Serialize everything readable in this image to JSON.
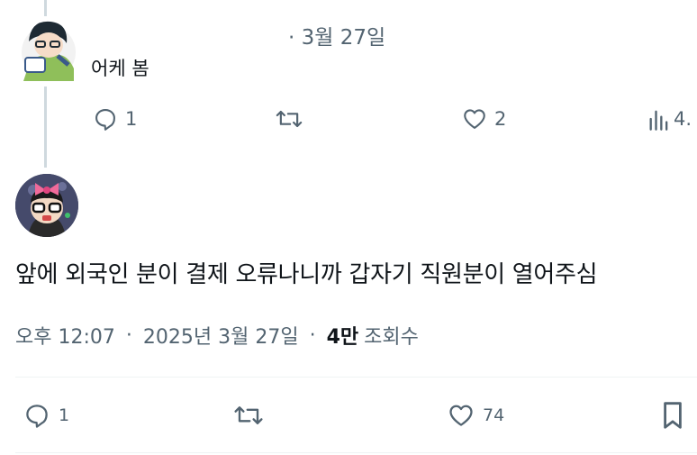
{
  "reply": {
    "date": "· 3월 27일",
    "text": "어케 봄",
    "actions": {
      "reply_count": "1",
      "like_count": "2",
      "view_count": "4."
    }
  },
  "main_tweet": {
    "text": "앞에 외국인 분이 결제 오류나니까 갑자기 직원분이 열어주심",
    "time": "오후 12:07",
    "separator": "·",
    "date": "2025년 3월 27일",
    "views_value": "4만",
    "views_label": "조회수",
    "actions": {
      "reply_count": "1",
      "like_count": "74"
    }
  },
  "colors": {
    "text_primary": "#0f1419",
    "text_secondary": "#536471",
    "thread_line": "#cfd9de",
    "divider": "#eff3f4"
  },
  "icons": [
    "reply-icon",
    "retweet-icon",
    "like-icon",
    "views-icon",
    "bookmark-icon"
  ]
}
